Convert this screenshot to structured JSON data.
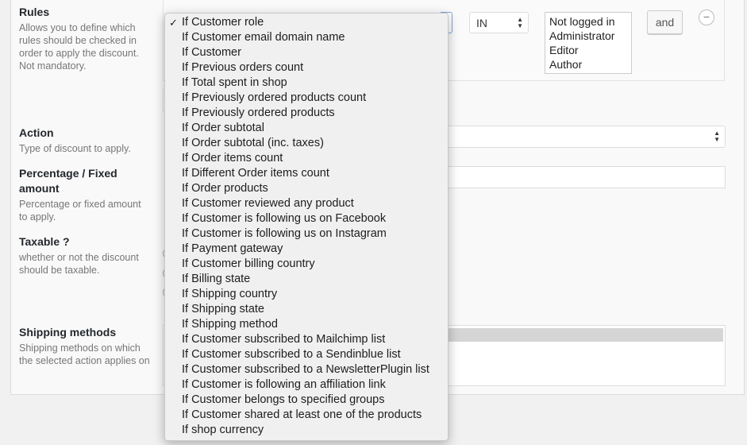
{
  "rules": {
    "label": "Rules",
    "description": "Allows you to define which rules should be checked in order to apply the discount. Not mandatory.",
    "operator": "IN",
    "roles": [
      "Not logged in",
      "Administrator",
      "Editor",
      "Author"
    ],
    "and_button": "and",
    "remove_icon": "minus-circle-icon"
  },
  "action": {
    "label": "Action",
    "description": "Type of discount to apply."
  },
  "amount": {
    "label": "Percentage / Fixed amount",
    "description": "Percentage or fixed amount to apply."
  },
  "taxable": {
    "label": "Taxable ?",
    "description": "whether or not the discount should be taxable."
  },
  "shipping": {
    "label": "Shipping methods",
    "description": "Shipping methods on which the selected action applies on"
  },
  "dropdown": {
    "selected": "If Customer role",
    "options": [
      "If Customer role",
      "If Customer email domain name",
      "If Customer",
      "If Previous orders count",
      "If Total spent in shop",
      "If Previously ordered products count",
      "If Previously ordered products",
      "If Order subtotal",
      "If Order subtotal (inc. taxes)",
      "If Order items count",
      "If Different Order items count",
      "If Order products",
      "If Customer reviewed any product",
      "If Customer is following us on Facebook",
      "If Customer is following us on Instagram",
      "If Payment gateway",
      "If Customer billing country",
      "If Billing state",
      "If Shipping country",
      "If Shipping state",
      "If Shipping method",
      "If Customer subscribed to Mailchimp list",
      "If Customer subscribed to a Sendinblue list",
      "If Customer subscribed to a NewsletterPlugin list",
      "If Customer is following an affiliation link",
      "If Customer belongs to specified groups",
      "If Customer shared at least one of the products",
      "If shop currency"
    ]
  }
}
